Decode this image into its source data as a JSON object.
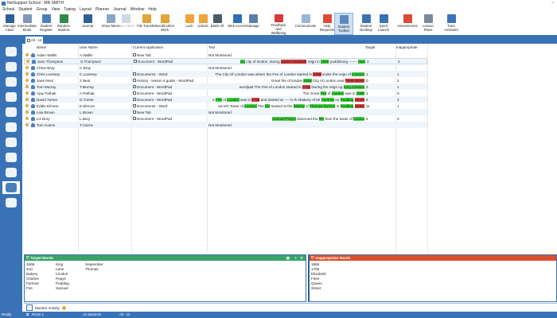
{
  "window": {
    "title": "NetSupport School - MR SMITH",
    "minimize": "–"
  },
  "menu": [
    "School",
    "Student",
    "Group",
    "View",
    "Typing",
    "Layout",
    "Planner",
    "Journal",
    "Window",
    "Help"
  ],
  "toolbar": [
    {
      "label": "Manage Class",
      "color": "#2c5f94"
    },
    {
      "label": "Intermediate Mode",
      "color": "#7d98b8"
    },
    {
      "label": "Student Register",
      "color": "#4a7fbf"
    },
    {
      "label": "Random Student",
      "color": "#2f8a4a"
    },
    {
      "label": "Journal",
      "color": "#2c5f94"
    },
    {
      "label": "Show Menu",
      "color": "#8aa6c7"
    },
    {
      "label": "View Client",
      "color": "#cfd8e2",
      "disabled": true
    },
    {
      "label": "File Transfer",
      "color": "#e0a43a"
    },
    {
      "label": "Send/Collect Work",
      "color": "#e0a43a"
    },
    {
      "label": "Lock",
      "color": "#f0a43a"
    },
    {
      "label": "Unlock",
      "color": "#f0a43a"
    },
    {
      "label": "Blank All",
      "color": "#4a5a6a"
    },
    {
      "label": "Web Access",
      "color": "#2c6fb5"
    },
    {
      "label": "Manage",
      "color": "#5a7fa8"
    },
    {
      "label": "Feedback and Wellbeing",
      "color": "#d83a3a"
    },
    {
      "label": "Communicate",
      "color": "#9ab5d6"
    },
    {
      "label": "Help Requests",
      "color": "#e04a3a"
    },
    {
      "label": "Student Toolbar",
      "color": "#5a8ac0",
      "selected": true
    },
    {
      "label": "Student Desktop",
      "color": "#3a73b5"
    },
    {
      "label": "Quick Launch",
      "color": "#3a73b5"
    },
    {
      "label": "Assessments",
      "color": "#d84a3a"
    },
    {
      "label": "Lesson Plans",
      "color": "#7a8a9a"
    },
    {
      "label": "Tutor Assistant",
      "color": "#3a73b5"
    }
  ],
  "tab": "All - 12",
  "sidebar": [
    "home-icon",
    "monitor-icon",
    "headset-icon",
    "head-icon",
    "globe-icon",
    "screen-icon",
    "clock-icon",
    "printer-icon",
    "disc-icon",
    "grid-monitor-icon",
    "presentation-icon"
  ],
  "columns": {
    "name": "Name",
    "user": "User Name",
    "app": "Current Application",
    "text": "Text",
    "target": "Target",
    "inappropriate": "Inappropriate"
  },
  "students": [
    {
      "name": "Adam Wallis",
      "user": "A.Wallis",
      "app": "New Tab",
      "text": [
        [
          "n",
          "Not Monitored"
        ]
      ],
      "target": "",
      "inap": ""
    },
    {
      "name": "Sam Thompson",
      "user": "S.Thompson",
      "app": "Document - WordPad",
      "text": [
        [
          "t",
          "ion"
        ],
        [
          "n",
          " city of london. during "
        ],
        [
          "x",
          "queen elizabeth"
        ],
        [
          "n",
          " reign in "
        ],
        [
          "t",
          "1666"
        ],
        [
          "n",
          " puddinlung ------- "
        ],
        [
          "t",
          "lane"
        ]
      ],
      "target": "2",
      "inap": "2"
    },
    {
      "name": "Chloe Bray",
      "user": "C.Bray",
      "app": "",
      "text": [
        [
          "n",
          "Not Monitored"
        ]
      ],
      "target": "",
      "inap": ""
    },
    {
      "name": "Chris Lovesey",
      "user": "C.Lovesey",
      "app": "Document1 - Word",
      "text": [
        [
          "n",
          "The City Of London was where the Fire of London started in "
        ],
        [
          "x",
          "1756"
        ],
        [
          "n",
          " under the reign of "
        ],
        [
          "t",
          "Charles"
        ]
      ],
      "target": "1",
      "inap": "1"
    },
    {
      "name": "Jane Neal",
      "user": "J.Neal",
      "app": "History - lesson 4 guide - WordPad",
      "text": [
        [
          "n",
          "Great fire of london "
        ],
        [
          "t",
          "1666"
        ],
        [
          "n",
          " City of London near "
        ],
        [
          "x",
          "Fleet Street"
        ]
      ],
      "target": "0",
      "inap": "2"
    },
    {
      "name": "Tom Murray",
      "user": "T.Murray",
      "app": "Document - WordPad",
      "text": [
        [
          "n",
          "wordpad The Fire of London started in "
        ],
        [
          "x",
          "1756"
        ],
        [
          "n",
          " During the reign og "
        ],
        [
          "t",
          "King Charles"
        ]
      ],
      "target": "2",
      "inap": "1"
    },
    {
      "name": "Ajay Pathak",
      "user": "A.Pathak",
      "app": "Document - WordPad",
      "text": [
        [
          "n",
          "The Great "
        ],
        [
          "t",
          "Fire"
        ],
        [
          "n",
          " of "
        ],
        [
          "t",
          "London"
        ],
        [
          "n",
          " was in "
        ],
        [
          "t",
          "1666"
        ]
      ],
      "target": "1",
      "inap": "0"
    },
    {
      "name": "David Turner",
      "user": "D.Turner",
      "app": "Document - WordPad",
      "text": [
        [
          "n",
          "e "
        ],
        [
          "t",
          "Fire"
        ],
        [
          "n",
          " of "
        ],
        [
          "t",
          "London"
        ],
        [
          "n",
          " was in "
        ],
        [
          "x",
          "1756"
        ],
        [
          "n",
          " and started at ---- in th ebakery of Mr "
        ],
        [
          "t",
          "Farriner"
        ],
        [
          "n",
          " on "
        ],
        [
          "t",
          "Pudding"
        ],
        [
          "n",
          " "
        ],
        [
          "x",
          "Street"
        ]
      ],
      "target": "4",
      "inap": "2"
    },
    {
      "name": "Eddie Elmore",
      "user": "E.Elmore",
      "app": "Document2 - Word",
      "text": [
        [
          "n",
          "ws teh Tower of "
        ],
        [
          "t",
          "London"
        ],
        [
          "n",
          " The "
        ],
        [
          "t",
          "fire"
        ],
        [
          "n",
          " started at the "
        ],
        [
          "t",
          "bakery"
        ],
        [
          "n",
          " of "
        ],
        [
          "t",
          "Thomas farriner"
        ],
        [
          "n",
          " in "
        ],
        [
          "t",
          "Pudding"
        ],
        [
          "n",
          " "
        ],
        [
          "x",
          "Street"
        ]
      ],
      "target": "11",
      "inap": "1"
    },
    {
      "name": "Lisa Brown",
      "user": "L.Brown",
      "app": "New Tab",
      "text": [
        [
          "n",
          "Not Monitored"
        ]
      ],
      "target": "",
      "inap": ""
    },
    {
      "name": "Liz Bury",
      "user": "L.Bury",
      "app": "Document - WordPad",
      "text": [
        [
          "t",
          "Samuel Pepys"
        ],
        [
          "n",
          " observed the "
        ],
        [
          "t",
          "fire"
        ],
        [
          "n",
          " from the tower of "
        ],
        [
          "t",
          "london"
        ]
      ],
      "target": "4",
      "inap": "0"
    },
    {
      "name": "Tom Cairns",
      "user": "T.Cairns",
      "app": "",
      "text": [
        [
          "n",
          "Not Monitored"
        ]
      ],
      "target": "",
      "inap": ""
    }
  ],
  "target_words": {
    "title": "Target Words",
    "cols": [
      [
        "1666",
        "2nd",
        "Bakery",
        "Charles",
        "Farriner",
        "Fire"
      ],
      [
        "King",
        "Lane",
        "London",
        "Pepys",
        "Pudding",
        "Samuel"
      ],
      [
        "September",
        "Thomas"
      ]
    ]
  },
  "inappropriate_words": {
    "title": "Inappropriate Words",
    "words": [
      "1566",
      "1756",
      "Elizabeth",
      "Fleet",
      "Queen",
      "Street"
    ]
  },
  "monitor": "Monitor Activity",
  "status": {
    "ready": "Ready",
    "room": "Room 1",
    "students": "12 Students",
    "group": "All - 12"
  },
  "colors": {
    "accent": "#3a73b5",
    "target": "#3ddc3d",
    "inappropriate": "#e23c3c",
    "target_header": "#3aa36a",
    "inap_header": "#d9502e"
  }
}
